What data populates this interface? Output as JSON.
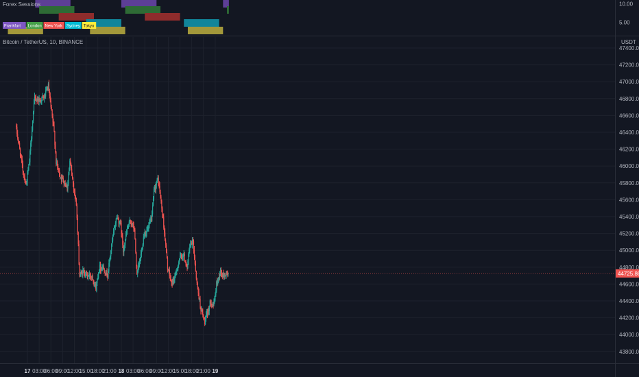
{
  "chart_data": [
    {
      "type": "bar",
      "title": "Forex Sessions",
      "ylim": [
        0,
        11
      ],
      "y_ticks": [
        "10.00",
        "5.00"
      ],
      "legend": [
        "Frankfurt",
        "London",
        "New York",
        "Sydney",
        "Tokyo"
      ],
      "colors": {
        "Frankfurt": "#5d3f96",
        "London": "#2e6b35",
        "New York": "#8e2c2c",
        "Sydney": "#11859a",
        "Tokyo": "#a3983a"
      },
      "sessions": [
        {
          "name": "Tokyo",
          "level": 1,
          "start": "2022-02-16 19:00",
          "end": "2022-02-17 04:00"
        },
        {
          "name": "Frankfurt",
          "level": 5,
          "start": "2022-02-17 02:00",
          "end": "2022-02-17 11:00"
        },
        {
          "name": "London",
          "level": 4,
          "start": "2022-02-17 03:00",
          "end": "2022-02-17 12:00"
        },
        {
          "name": "New York",
          "level": 3,
          "start": "2022-02-17 08:00",
          "end": "2022-02-17 17:00"
        },
        {
          "name": "Sydney",
          "level": 2,
          "start": "2022-02-17 15:00",
          "end": "2022-02-18 00:00"
        },
        {
          "name": "Tokyo",
          "level": 1,
          "start": "2022-02-17 16:00",
          "end": "2022-02-18 01:00"
        },
        {
          "name": "Frankfurt",
          "level": 5,
          "start": "2022-02-18 00:00",
          "end": "2022-02-18 09:00"
        },
        {
          "name": "London",
          "level": 4,
          "start": "2022-02-18 01:00",
          "end": "2022-02-18 10:00"
        },
        {
          "name": "New York",
          "level": 3,
          "start": "2022-02-18 06:00",
          "end": "2022-02-18 15:00"
        },
        {
          "name": "Sydney",
          "level": 2,
          "start": "2022-02-18 16:00",
          "end": "2022-02-19 01:00"
        },
        {
          "name": "Tokyo",
          "level": 1,
          "start": "2022-02-18 17:00",
          "end": "2022-02-19 02:00"
        },
        {
          "name": "Frankfurt",
          "level": 5,
          "start": "2022-02-19 02:00",
          "end": "2022-02-19 03:30"
        },
        {
          "name": "London",
          "level": 4,
          "start": "2022-02-19 03:00",
          "end": "2022-02-19 03:30"
        }
      ]
    },
    {
      "type": "candlestick",
      "title": "Bitcoin / TetherUS, 10, BINANCE",
      "ylabel": "USDT",
      "ylim": [
        43600,
        47400
      ],
      "y_ticks": [
        "47400.00",
        "47200.00",
        "47000.00",
        "46800.00",
        "46600.00",
        "46400.00",
        "46200.00",
        "46000.00",
        "45800.00",
        "45600.00",
        "45400.00",
        "45200.00",
        "45000.00",
        "44800.00",
        "44600.00",
        "44400.00",
        "44200.00",
        "44000.00",
        "43800.00"
      ],
      "x_ticks": [
        "17",
        "03:00",
        "06:00",
        "09:00",
        "12:00",
        "15:00",
        "18:00",
        "21:00",
        "18",
        "03:00",
        "06:00",
        "09:00",
        "12:00",
        "15:00",
        "18:00",
        "21:00",
        "19"
      ],
      "x_tick_times": [
        "2022-02-17 00:00",
        "2022-02-17 03:00",
        "2022-02-17 06:00",
        "2022-02-17 09:00",
        "2022-02-17 12:00",
        "2022-02-17 15:00",
        "2022-02-17 18:00",
        "2022-02-17 21:00",
        "2022-02-18 00:00",
        "2022-02-18 03:00",
        "2022-02-18 06:00",
        "2022-02-18 09:00",
        "2022-02-18 12:00",
        "2022-02-18 15:00",
        "2022-02-18 18:00",
        "2022-02-18 21:00",
        "2022-02-19 00:00"
      ],
      "start": "2022-02-16 21:10",
      "interval_minutes": 10,
      "last_price": "44725.86",
      "up_color": "#26a69a",
      "down_color": "#ef5350",
      "price_path": [
        {
          "t": "2022-02-16 21:10",
          "p": 46480
        },
        {
          "t": "2022-02-16 22:00",
          "p": 46250
        },
        {
          "t": "2022-02-16 23:00",
          "p": 45950
        },
        {
          "t": "2022-02-16 23:50",
          "p": 45780
        },
        {
          "t": "2022-02-17 00:40",
          "p": 46050
        },
        {
          "t": "2022-02-17 01:20",
          "p": 46450
        },
        {
          "t": "2022-02-17 02:00",
          "p": 46800
        },
        {
          "t": "2022-02-17 03:20",
          "p": 46780
        },
        {
          "t": "2022-02-17 04:30",
          "p": 46820
        },
        {
          "t": "2022-02-17 05:30",
          "p": 46950
        },
        {
          "t": "2022-02-17 06:00",
          "p": 46750
        },
        {
          "t": "2022-02-17 07:00",
          "p": 46400
        },
        {
          "t": "2022-02-17 07:30",
          "p": 46050
        },
        {
          "t": "2022-02-17 08:30",
          "p": 45880
        },
        {
          "t": "2022-02-17 09:30",
          "p": 45820
        },
        {
          "t": "2022-02-17 10:20",
          "p": 45750
        },
        {
          "t": "2022-02-17 11:00",
          "p": 46050
        },
        {
          "t": "2022-02-17 11:40",
          "p": 45850
        },
        {
          "t": "2022-02-17 12:40",
          "p": 45550
        },
        {
          "t": "2022-02-17 13:30",
          "p": 44700
        },
        {
          "t": "2022-02-17 14:30",
          "p": 44750
        },
        {
          "t": "2022-02-17 15:30",
          "p": 44700
        },
        {
          "t": "2022-02-17 16:40",
          "p": 44700
        },
        {
          "t": "2022-02-17 17:40",
          "p": 44550
        },
        {
          "t": "2022-02-17 18:30",
          "p": 44800
        },
        {
          "t": "2022-02-17 19:30",
          "p": 44800
        },
        {
          "t": "2022-02-17 20:40",
          "p": 44700
        },
        {
          "t": "2022-02-17 21:30",
          "p": 45000
        },
        {
          "t": "2022-02-17 22:30",
          "p": 45300
        },
        {
          "t": "2022-02-17 23:00",
          "p": 45400
        },
        {
          "t": "2022-02-18 00:00",
          "p": 45300
        },
        {
          "t": "2022-02-18 00:40",
          "p": 45000
        },
        {
          "t": "2022-02-18 01:40",
          "p": 45250
        },
        {
          "t": "2022-02-18 02:30",
          "p": 45350
        },
        {
          "t": "2022-02-18 03:30",
          "p": 45250
        },
        {
          "t": "2022-02-18 04:10",
          "p": 44700
        },
        {
          "t": "2022-02-18 05:00",
          "p": 44900
        },
        {
          "t": "2022-02-18 06:00",
          "p": 45200
        },
        {
          "t": "2022-02-18 07:00",
          "p": 45250
        },
        {
          "t": "2022-02-18 08:00",
          "p": 45400
        },
        {
          "t": "2022-02-18 08:30",
          "p": 45700
        },
        {
          "t": "2022-02-18 09:30",
          "p": 45850
        },
        {
          "t": "2022-02-18 10:00",
          "p": 45700
        },
        {
          "t": "2022-02-18 11:00",
          "p": 45300
        },
        {
          "t": "2022-02-18 12:00",
          "p": 44800
        },
        {
          "t": "2022-02-18 13:00",
          "p": 44600
        },
        {
          "t": "2022-02-18 14:00",
          "p": 44700
        },
        {
          "t": "2022-02-18 15:00",
          "p": 44900
        },
        {
          "t": "2022-02-18 16:00",
          "p": 44950
        },
        {
          "t": "2022-02-18 17:00",
          "p": 44800
        },
        {
          "t": "2022-02-18 17:40",
          "p": 45050
        },
        {
          "t": "2022-02-18 18:30",
          "p": 45100
        },
        {
          "t": "2022-02-18 19:30",
          "p": 44600
        },
        {
          "t": "2022-02-18 20:30",
          "p": 44300
        },
        {
          "t": "2022-02-18 21:30",
          "p": 44150
        },
        {
          "t": "2022-02-18 22:10",
          "p": 44250
        },
        {
          "t": "2022-02-18 23:00",
          "p": 44400
        },
        {
          "t": "2022-02-18 23:50",
          "p": 44350
        },
        {
          "t": "2022-02-19 00:30",
          "p": 44600
        },
        {
          "t": "2022-02-19 01:30",
          "p": 44750
        },
        {
          "t": "2022-02-19 02:00",
          "p": 44700
        },
        {
          "t": "2022-02-19 03:20",
          "p": 44726
        }
      ]
    }
  ]
}
